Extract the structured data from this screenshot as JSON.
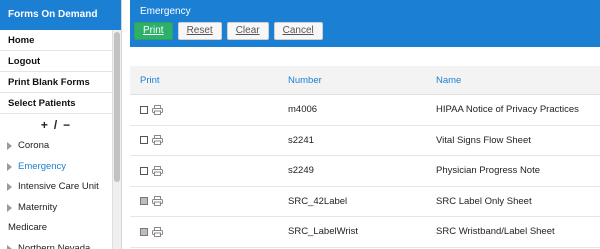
{
  "sidebar": {
    "title": "Forms On Demand",
    "links": [
      "Home",
      "Logout",
      "Print Blank Forms",
      "Select Patients"
    ],
    "toggle": {
      "plus": "+",
      "sep": "/",
      "minus": "−"
    },
    "tree": [
      {
        "label": "Corona",
        "expandable": true,
        "active": false
      },
      {
        "label": "Emergency",
        "expandable": true,
        "active": true
      },
      {
        "label": "Intensive Care Unit",
        "expandable": true,
        "active": false
      },
      {
        "label": "Maternity",
        "expandable": true,
        "active": false
      },
      {
        "label": "Medicare",
        "expandable": false,
        "active": false
      },
      {
        "label": "Northern Nevada",
        "expandable": true,
        "active": false
      }
    ]
  },
  "header": {
    "title": "Emergency",
    "buttons": {
      "print": "Print",
      "reset": "Reset",
      "clear": "Clear",
      "cancel": "Cancel"
    }
  },
  "table": {
    "columns": {
      "print": "Print",
      "number": "Number",
      "name": "Name"
    },
    "rows": [
      {
        "number": "m4006",
        "name": "HIPAA Notice of Privacy Practices",
        "checkbox_shaded": false
      },
      {
        "number": "s2241",
        "name": "Vital Signs Flow Sheet",
        "checkbox_shaded": false
      },
      {
        "number": "s2249",
        "name": "Physician Progress Note",
        "checkbox_shaded": false
      },
      {
        "number": "SRC_42Label",
        "name": "SRC Label Only Sheet",
        "checkbox_shaded": true
      },
      {
        "number": "SRC_LabelWrist",
        "name": "SRC Wristband/Label Sheet",
        "checkbox_shaded": true
      }
    ]
  },
  "icons": {
    "row_print": "printer-icon",
    "tree_arrow": "caret-right-icon"
  },
  "colors": {
    "brand": "#1b7fd4",
    "print_button": "#2eb06b"
  }
}
